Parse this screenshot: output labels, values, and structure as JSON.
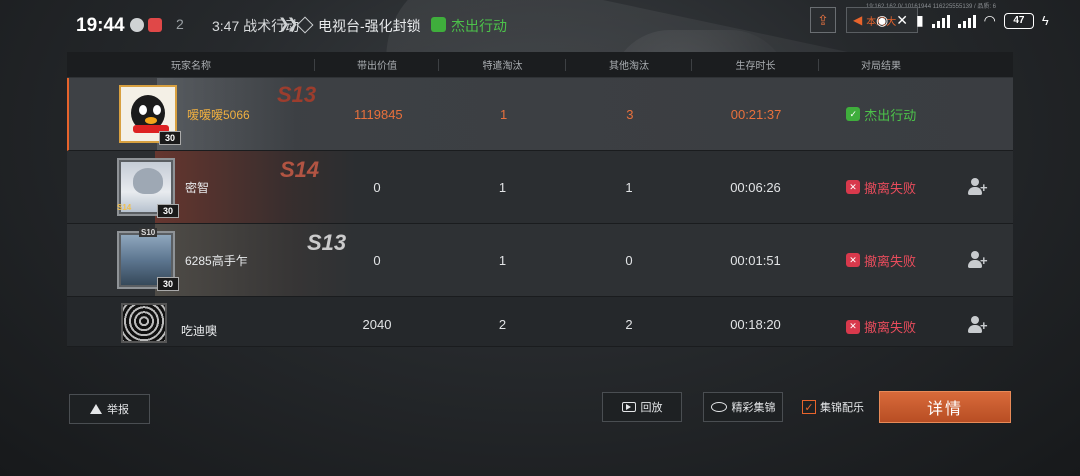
{
  "status_bar": {
    "time": "19:44",
    "battery": "47",
    "info_line": "19:162 162 0/ 10161944 116225555139 / 品质: 6"
  },
  "header": {
    "date_fragment": "2",
    "mode_time": "3:47",
    "mode": "战术行动",
    "map": "电视台-强化封锁",
    "result": "杰出行动",
    "highlight_label": "本局大",
    "result_color": "#4cc24a"
  },
  "table": {
    "columns": [
      "玩家名称",
      "带出价值",
      "特遣淘汰",
      "其他淘汰",
      "生存时长",
      "对局结果"
    ],
    "rows": [
      {
        "name": "嗳嗳嗳5066",
        "level": "30",
        "season": "S13",
        "banner_tag": "S13",
        "value": "1119845",
        "special_kills": "1",
        "other_kills": "3",
        "survival": "00:21:37",
        "result": "杰出行动",
        "result_type": "success",
        "show_add": false
      },
      {
        "name": "密智",
        "level": "30",
        "season": "S14",
        "banner_tag": "S14",
        "value": "0",
        "special_kills": "1",
        "other_kills": "1",
        "survival": "00:06:26",
        "result": "撤离失败",
        "result_type": "fail",
        "show_add": true
      },
      {
        "name": "6285高手乍",
        "level": "30",
        "season": "S10",
        "banner_tag": "S13",
        "value": "0",
        "special_kills": "1",
        "other_kills": "0",
        "survival": "00:01:51",
        "result": "撤离失败",
        "result_type": "fail",
        "show_add": true
      },
      {
        "name": "吃迪噢",
        "level": "",
        "season": "",
        "banner_tag": "",
        "value": "2040",
        "special_kills": "2",
        "other_kills": "2",
        "survival": "00:18:20",
        "result": "撤离失败",
        "result_type": "fail",
        "show_add": true
      }
    ]
  },
  "footer": {
    "report": "举报",
    "replay": "回放",
    "clips": "精彩集锦",
    "clips_music": "集锦配乐",
    "clips_music_checked": true,
    "details": "详情"
  },
  "colors": {
    "accent": "#e8642c",
    "success": "#4cc24a",
    "fail": "#e84c5c"
  }
}
